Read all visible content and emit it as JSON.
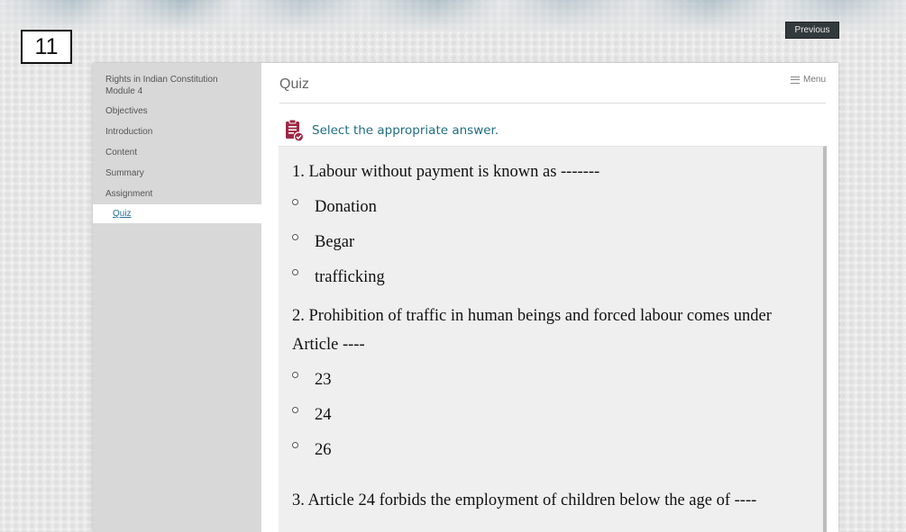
{
  "slide_number": "11",
  "header": {
    "previous_label": "Previous"
  },
  "sidebar": {
    "title": "Rights in Indian Constitution Module 4",
    "items": [
      {
        "label": "Objectives"
      },
      {
        "label": "Introduction"
      },
      {
        "label": "Content"
      },
      {
        "label": "Summary"
      },
      {
        "label": "Assignment"
      },
      {
        "label": "Quiz",
        "active": true
      }
    ]
  },
  "main": {
    "title": "Quiz",
    "menu_label": "Menu",
    "instruction": "Select the appropriate answer.",
    "icons": {
      "instruction": "clipboard-check-icon",
      "menu": "hamburger-icon"
    },
    "colors": {
      "instruction_icon": "#9e2845",
      "instruction_text": "#1f6e80",
      "active_link": "#2a6f9a"
    }
  },
  "questions": [
    {
      "text": "1. Labour without payment is known as -------",
      "options": [
        "Donation",
        "Begar",
        "trafficking"
      ]
    },
    {
      "text": "2. Prohibition of traffic in human beings and forced labour comes under Article ----",
      "options": [
        "23",
        "24",
        "26"
      ]
    },
    {
      "text": "3. Article 24 forbids the employment of children below the age of ----",
      "options": []
    }
  ]
}
